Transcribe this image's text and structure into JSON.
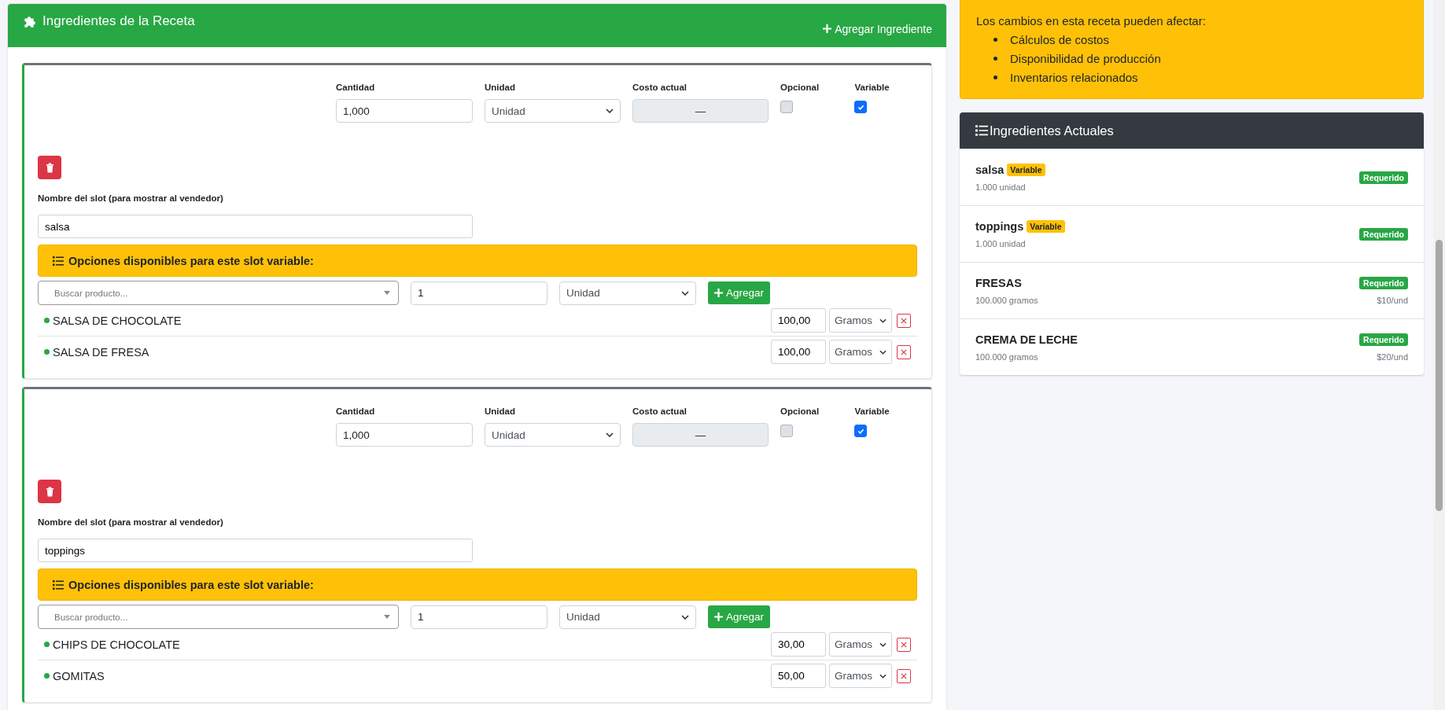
{
  "recipe": {
    "title": "Ingredientes de la Receta",
    "add_button": "Agregar Ingrediente",
    "ingredients": [
      {
        "fields": [
          {
            "kind": "input",
            "label": "Cantidad",
            "value": "1,000"
          },
          {
            "kind": "select",
            "label": "Unidad",
            "value": "Unidad"
          },
          {
            "kind": "readonly",
            "label": "Costo actual",
            "value": "—"
          },
          {
            "kind": "checkbox",
            "label": "Opcional",
            "checked": false
          },
          {
            "kind": "checkbox",
            "label": "Variable",
            "checked": true
          }
        ],
        "slot_label": "Nombre del slot (para mostrar al vendedor)",
        "slot_name": "salsa",
        "options_title": "Opciones disponibles para este slot variable:",
        "search_placeholder": "Buscar producto...",
        "add_qty": "1",
        "add_unit": "Unidad",
        "add_button": "Agregar",
        "options": [
          {
            "name": "SALSA DE CHOCOLATE",
            "qty": "100,00",
            "unit": "Gramos"
          },
          {
            "name": "SALSA DE FRESA",
            "qty": "100,00",
            "unit": "Gramos"
          }
        ]
      },
      {
        "fields": [
          {
            "kind": "input",
            "label": "Cantidad",
            "value": "1,000"
          },
          {
            "kind": "select",
            "label": "Unidad",
            "value": "Unidad"
          },
          {
            "kind": "readonly",
            "label": "Costo actual",
            "value": "—"
          },
          {
            "kind": "checkbox",
            "label": "Opcional",
            "checked": false
          },
          {
            "kind": "checkbox",
            "label": "Variable",
            "checked": true
          }
        ],
        "slot_label": "Nombre del slot (para mostrar al vendedor)",
        "slot_name": "toppings",
        "options_title": "Opciones disponibles para este slot variable:",
        "search_placeholder": "Buscar producto...",
        "add_qty": "1",
        "add_unit": "Unidad",
        "add_button": "Agregar",
        "options": [
          {
            "name": "CHIPS DE CHOCOLATE",
            "qty": "30,00",
            "unit": "Gramos"
          },
          {
            "name": "GOMITAS",
            "qty": "50,00",
            "unit": "Gramos"
          }
        ]
      }
    ]
  },
  "notice": {
    "intro": "Los cambios en esta receta pueden afectar:",
    "items": [
      "Cálculos de costos",
      "Disponibilidad de producción",
      "Inventarios relacionados"
    ]
  },
  "current": {
    "title": "Ingredientes Actuales",
    "items": [
      {
        "name": "salsa",
        "tag": "Variable",
        "qty": "1.000 unidad",
        "status": "Requerido"
      },
      {
        "name": "toppings",
        "tag": "Variable",
        "qty": "1.000 unidad",
        "status": "Requerido"
      },
      {
        "name": "FRESAS",
        "qty": "100.000 gramos",
        "status": "Requerido",
        "price": "$10/und"
      },
      {
        "name": "CREMA DE LECHE",
        "qty": "100.000 gramos",
        "status": "Requerido",
        "price": "$20/und"
      }
    ]
  }
}
